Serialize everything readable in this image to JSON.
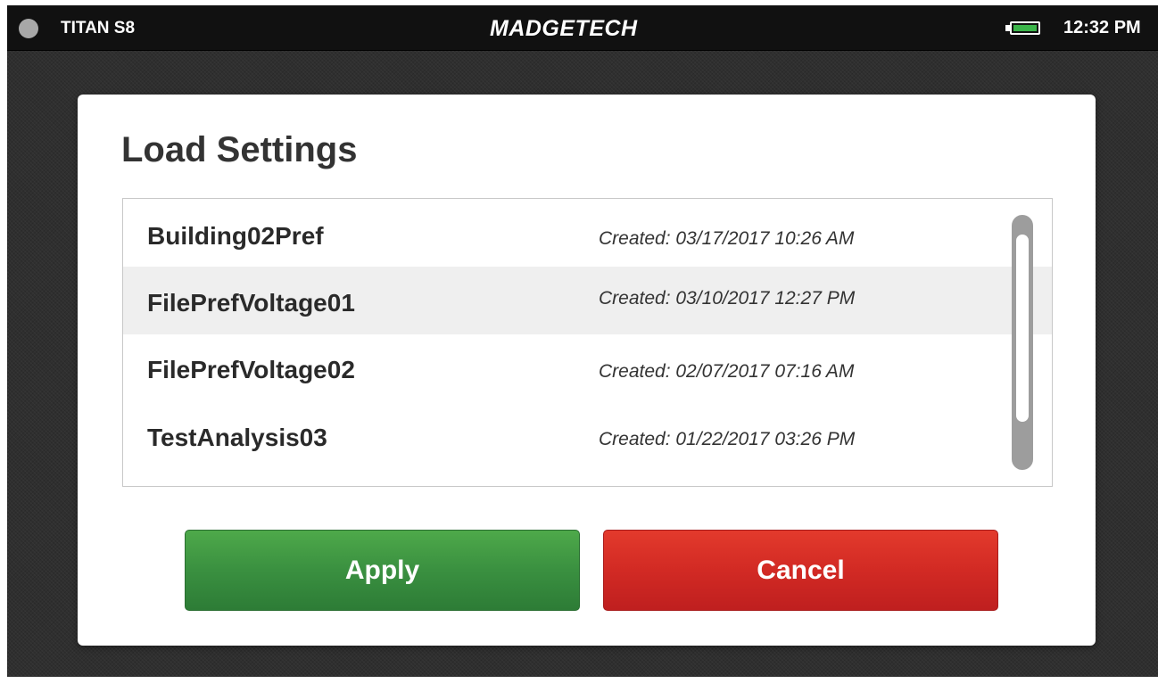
{
  "status_bar": {
    "device_name": "TITAN S8",
    "brand": "MADGETECH",
    "time": "12:32 PM",
    "battery_icon": "battery-full-icon",
    "battery_color": "#3bb54a"
  },
  "dialog": {
    "title": "Load Settings",
    "files": [
      {
        "name": "Building02Pref",
        "created": "Created: 03/17/2017 10:26 AM",
        "selected": false
      },
      {
        "name": "FilePrefVoltage01",
        "created": "Created: 03/10/2017 12:27 PM",
        "selected": true
      },
      {
        "name": "FilePrefVoltage02",
        "created": "Created: 02/07/2017 07:16 AM",
        "selected": false
      },
      {
        "name": "TestAnalysis03",
        "created": "Created: 01/22/2017 03:26 PM",
        "selected": false
      }
    ],
    "apply_label": "Apply",
    "cancel_label": "Cancel",
    "apply_color": "#3a9040",
    "cancel_color": "#d22a24"
  }
}
